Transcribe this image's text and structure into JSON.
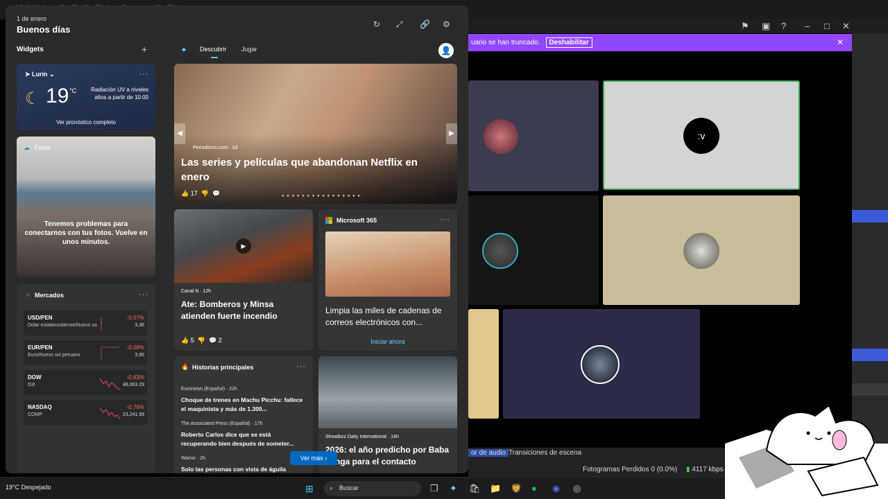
{
  "obs": {
    "title": "OBS 31.0.4 - Perfil: Sin Título - Escenas: Sin Título",
    "truncation_text": "uario se han truncado.",
    "disable_button": "Deshabilitar",
    "close_icon": "✕",
    "tab_audio": "or de audio",
    "tab_transitions": "Transiciones de escena",
    "dropped_frames": "Fotogramas Perdidos 0 (0.0%)",
    "bitrate": "4117 kbps",
    "discord_tile_text": ":v"
  },
  "widgets": {
    "date": "1 de enero",
    "greeting": "Buenos días",
    "section_title": "Widgets",
    "add_icon": "+",
    "more_icon": "···",
    "weather": {
      "location": "Lurín",
      "temperature": "19",
      "unit": "°C",
      "uv_text": "Radiación UV a niveles altos a partir de 10:00",
      "forecast_link": "Ver pronóstico completo"
    },
    "photos": {
      "title": "Fotos",
      "message": "Tenemos problemas para conectarnos con tus fotos. Vuelve en unos minutos."
    },
    "markets": {
      "title": "Mercados",
      "rows": [
        {
          "symbol": "USD/PEN",
          "name": "Dólar estadounidense/Nuevo so...",
          "change": "-0,07%",
          "value": "3,36"
        },
        {
          "symbol": "EUR/PEN",
          "name": "Euro/Nuevo sol peruano",
          "change": "-0,08%",
          "value": "3,95"
        },
        {
          "symbol": "DOW",
          "name": "DJI",
          "change": "-0.63%",
          "value": "48,063.29"
        },
        {
          "symbol": "NASDAQ",
          "name": "COMP",
          "change": "-0.76%",
          "value": "23,241.99"
        }
      ]
    }
  },
  "feed": {
    "tabs": {
      "discover": "Descubrir",
      "play": "Jugar"
    },
    "hero": {
      "source": "Periodismo.com · 1d",
      "title": "Las series y películas que abandonan Netflix en enero",
      "likes": "17"
    },
    "story": {
      "source": "Canal N · 12h",
      "title": "Ate: Bomberos y Minsa atienden fuerte incendio",
      "likes": "5",
      "comments": "2"
    },
    "m365": {
      "title": "Microsoft 365",
      "text": "Limpia las miles de cadenas de correos electrónicos con...",
      "link": "Iniciar ahora"
    },
    "top_stories": {
      "title": "Historias principales",
      "items": [
        {
          "source": "Euronews (Español) · 22h",
          "title": "Choque de trenes en Machu Picchu: fallece el maquinista y más de 1.300..."
        },
        {
          "source": "The Associated Press (Español) · 17h",
          "title": "Roberto Carlos dice que se está recuperando bien después de someter..."
        },
        {
          "source": "Wamiz · 2h",
          "title": "Solo las personas con vista de águila"
        }
      ]
    },
    "ufo": {
      "source": "Showbizz Daily International · 14h",
      "title": "2026: el año predicho por Baba Vanga para el contacto"
    },
    "see_more": "Ver más"
  },
  "taskbar": {
    "weather": "19°C Despejado",
    "search": "Buscar"
  },
  "colors": {
    "accent": "#0067c0",
    "twitch_purple": "#9146ff",
    "negative": "#ff6b6b"
  }
}
